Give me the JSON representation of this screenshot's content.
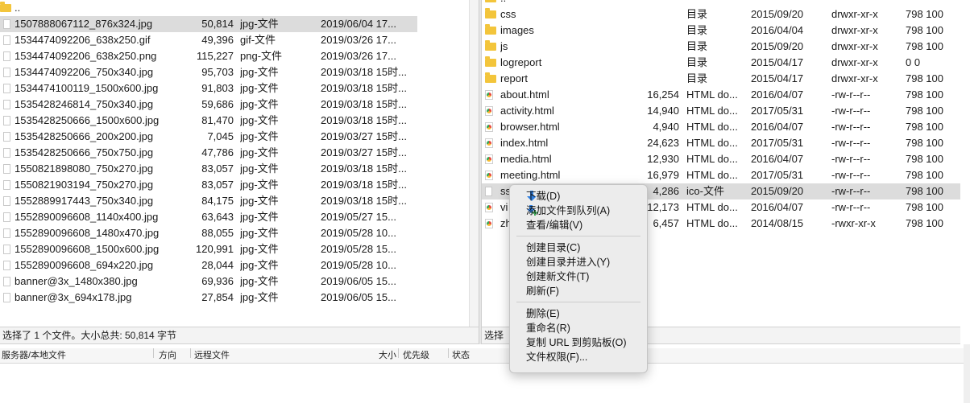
{
  "local_files": {
    "parent_dir": "..",
    "rows": [
      {
        "name": "1507888067112_876x324.jpg",
        "size": "50,814",
        "type": "jpg-文件",
        "date": "2019/06/04 17...",
        "selected": true
      },
      {
        "name": "1534474092206_638x250.gif",
        "size": "49,396",
        "type": "gif-文件",
        "date": "2019/03/26 17..."
      },
      {
        "name": "1534474092206_638x250.png",
        "size": "115,227",
        "type": "png-文件",
        "date": "2019/03/26 17..."
      },
      {
        "name": "1534474092206_750x340.jpg",
        "size": "95,703",
        "type": "jpg-文件",
        "date": "2019/03/18 15时..."
      },
      {
        "name": "1534474100119_1500x600.jpg",
        "size": "91,803",
        "type": "jpg-文件",
        "date": "2019/03/18 15时..."
      },
      {
        "name": "1535428246814_750x340.jpg",
        "size": "59,686",
        "type": "jpg-文件",
        "date": "2019/03/18 15时..."
      },
      {
        "name": "1535428250666_1500x600.jpg",
        "size": "81,470",
        "type": "jpg-文件",
        "date": "2019/03/18 15时..."
      },
      {
        "name": "1535428250666_200x200.jpg",
        "size": "7,045",
        "type": "jpg-文件",
        "date": "2019/03/27 15时..."
      },
      {
        "name": "1535428250666_750x750.jpg",
        "size": "47,786",
        "type": "jpg-文件",
        "date": "2019/03/27 15时..."
      },
      {
        "name": "1550821898080_750x270.jpg",
        "size": "83,057",
        "type": "jpg-文件",
        "date": "2019/03/18 15时..."
      },
      {
        "name": "1550821903194_750x270.jpg",
        "size": "83,057",
        "type": "jpg-文件",
        "date": "2019/03/18 15时..."
      },
      {
        "name": "1552889917443_750x340.jpg",
        "size": "84,175",
        "type": "jpg-文件",
        "date": "2019/03/18 15时..."
      },
      {
        "name": "1552890096608_1140x400.jpg",
        "size": "63,643",
        "type": "jpg-文件",
        "date": "2019/05/27 15..."
      },
      {
        "name": "1552890096608_1480x470.jpg",
        "size": "88,055",
        "type": "jpg-文件",
        "date": "2019/05/28 10..."
      },
      {
        "name": "1552890096608_1500x600.jpg",
        "size": "120,991",
        "type": "jpg-文件",
        "date": "2019/05/28 15..."
      },
      {
        "name": "1552890096608_694x220.jpg",
        "size": "28,044",
        "type": "jpg-文件",
        "date": "2019/05/28 10..."
      },
      {
        "name": "banner@3x_1480x380.jpg",
        "size": "69,936",
        "type": "jpg-文件",
        "date": "2019/06/05 15..."
      },
      {
        "name": "banner@3x_694x178.jpg",
        "size": "27,854",
        "type": "jpg-文件",
        "date": "2019/06/05 15..."
      }
    ],
    "status": "选择了 1 个文件。大小总共: 50,814 字节"
  },
  "remote_files": {
    "parent_dir": "..",
    "rows": [
      {
        "icon": "folder-icon",
        "name": "css",
        "size": "",
        "type": "目录",
        "date": "2015/09/20",
        "perm": "drwxr-xr-x",
        "owner": "798 100"
      },
      {
        "icon": "folder-icon",
        "name": "images",
        "size": "",
        "type": "目录",
        "date": "2016/04/04",
        "perm": "drwxr-xr-x",
        "owner": "798 100"
      },
      {
        "icon": "folder-icon",
        "name": "js",
        "size": "",
        "type": "目录",
        "date": "2015/09/20",
        "perm": "drwxr-xr-x",
        "owner": "798 100"
      },
      {
        "icon": "folder-icon",
        "name": "logreport",
        "size": "",
        "type": "目录",
        "date": "2015/04/17",
        "perm": "drwxr-xr-x",
        "owner": "0 0"
      },
      {
        "icon": "folder-icon",
        "name": "report",
        "size": "",
        "type": "目录",
        "date": "2015/04/17",
        "perm": "drwxr-xr-x",
        "owner": "798 100"
      },
      {
        "icon": "html-file-icon",
        "name": "about.html",
        "size": "16,254",
        "type": "HTML do...",
        "date": "2016/04/07",
        "perm": "-rw-r--r--",
        "owner": "798 100"
      },
      {
        "icon": "html-file-icon",
        "name": "activity.html",
        "size": "14,940",
        "type": "HTML do...",
        "date": "2017/05/31",
        "perm": "-rw-r--r--",
        "owner": "798 100"
      },
      {
        "icon": "html-file-icon",
        "name": "browser.html",
        "size": "4,940",
        "type": "HTML do...",
        "date": "2016/04/07",
        "perm": "-rw-r--r--",
        "owner": "798 100"
      },
      {
        "icon": "html-file-icon",
        "name": "index.html",
        "size": "24,623",
        "type": "HTML do...",
        "date": "2017/05/31",
        "perm": "-rw-r--r--",
        "owner": "798 100"
      },
      {
        "icon": "html-file-icon",
        "name": "media.html",
        "size": "12,930",
        "type": "HTML do...",
        "date": "2016/04/07",
        "perm": "-rw-r--r--",
        "owner": "798 100"
      },
      {
        "icon": "html-file-icon",
        "name": "meeting.html",
        "size": "16,979",
        "type": "HTML do...",
        "date": "2017/05/31",
        "perm": "-rw-r--r--",
        "owner": "798 100"
      },
      {
        "icon": "file-icon",
        "name": "ss",
        "size": "4,286",
        "type": "ico-文件",
        "date": "2015/09/20",
        "perm": "-rw-r--r--",
        "owner": "798 100",
        "selected": true
      },
      {
        "icon": "html-file-icon",
        "name": "vi",
        "size": "12,173",
        "type": "HTML do...",
        "date": "2016/04/07",
        "perm": "-rw-r--r--",
        "owner": "798 100"
      },
      {
        "icon": "html-file-icon",
        "name": "zh",
        "size": "6,457",
        "type": "HTML do...",
        "date": "2014/08/15",
        "perm": "-rwxr-xr-x",
        "owner": "798 100"
      }
    ],
    "status": "选择"
  },
  "transfer_queue": {
    "columns": [
      "服务器/本地文件",
      "方向",
      "远程文件",
      "大小",
      "优先级",
      "状态"
    ]
  },
  "context_menu": {
    "groups": [
      [
        {
          "label": "下载(D)",
          "icon": "download-arrow-icon"
        },
        {
          "label": "添加文件到队列(A)",
          "icon": "add-to-queue-icon"
        },
        {
          "label": "查看/编辑(V)"
        }
      ],
      [
        {
          "label": "创建目录(C)"
        },
        {
          "label": "创建目录并进入(Y)"
        },
        {
          "label": "创建新文件(T)"
        },
        {
          "label": "刷新(F)"
        }
      ],
      [
        {
          "label": "删除(E)"
        },
        {
          "label": "重命名(R)"
        },
        {
          "label": "复制 URL 到剪贴板(O)"
        },
        {
          "label": "文件权限(F)..."
        }
      ]
    ]
  },
  "colors": {
    "selection": "#dcdcdc",
    "folder": "#f3c53b",
    "download_icon": "#2f7fe0",
    "queue_icon": "#36a852"
  }
}
